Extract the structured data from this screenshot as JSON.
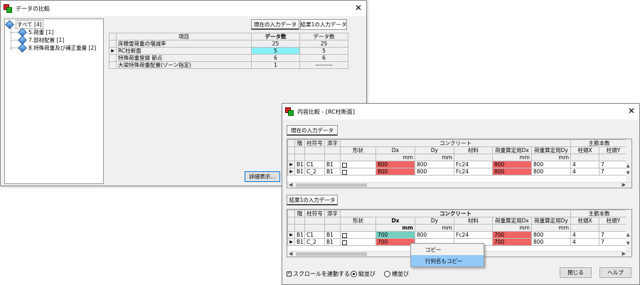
{
  "main_window": {
    "title": "データの比較",
    "tree": [
      {
        "label": "すべて [4]"
      },
      {
        "label": "5.荷重 [1]"
      },
      {
        "label": "7.部材配置 [1]"
      },
      {
        "label": "8.特殊荷重及び補正重量 [2]"
      }
    ],
    "tabs": {
      "current": "現在の入力データ",
      "result": "結果1の入力データ"
    },
    "table": {
      "headers": [
        "項目",
        "データ数",
        "データ数"
      ],
      "rows": [
        {
          "item": "床積雪荷重の増減率",
          "a": "25",
          "b": "25"
        },
        {
          "item": "RC柱断面",
          "a": "5",
          "b": "5"
        },
        {
          "item": "特殊荷重登録 節点",
          "a": "6",
          "b": "6"
        },
        {
          "item": "大梁特殊荷重配置(ゾーン指定)",
          "a": "1",
          "b": "---------"
        }
      ]
    },
    "detail_button": "詳細表示..."
  },
  "compare_window": {
    "title": "内容比較 - [RC柱断面]",
    "section_current": "現在の入力データ",
    "section_result": "結果1の入力データ",
    "header": {
      "kai": "階",
      "hashira": "柱符号",
      "soeji": "添字",
      "concrete": "コンクリート",
      "main_bar": "主筋本数",
      "keijo": "形状",
      "dx": "Dx",
      "dy": "Dy",
      "zairyo": "材料",
      "kajudx": "荷重算定用Dx",
      "kajudy": "荷重算定用Dy",
      "barx": "柱頭X",
      "bary": "柱頭Y",
      "unit": "mm"
    },
    "current_rows": [
      {
        "kai": "B1",
        "hashira": "C1",
        "soeji": "B1",
        "dx": "800",
        "dy": "800",
        "zairyo": "Fc24",
        "kdx": "800",
        "kdy": "800",
        "bx": "4",
        "by": "7"
      },
      {
        "kai": "B1",
        "hashira": "C_2",
        "soeji": "B1",
        "dx": "800",
        "dy": "800",
        "zairyo": "Fc24",
        "kdx": "800",
        "kdy": "800",
        "bx": "4",
        "by": "7"
      }
    ],
    "result_rows": [
      {
        "kai": "B1",
        "hashira": "C1",
        "soeji": "B1",
        "dx": "700",
        "dy": "800",
        "zairyo": "Fc24",
        "kdx": "700",
        "kdy": "800",
        "bx": "4",
        "by": "7"
      },
      {
        "kai": "B1",
        "hashira": "C_2",
        "soeji": "B1",
        "dx": "700",
        "dy": "",
        "zairyo": "",
        "kdx": "700",
        "kdy": "800",
        "bx": "4",
        "by": "7"
      }
    ],
    "context_menu": [
      "コピー",
      "行列名もコピー"
    ],
    "sync_scroll": "スクロールを連動する",
    "radio_vertical": "縦並び",
    "radio_horizontal": "横並び",
    "close_button": "閉じる",
    "help_button": "ヘルプ"
  },
  "colors": {
    "highlight_cyan": "#88eef8",
    "diff_red": "#f06464",
    "diff_teal": "#74cfc0",
    "menu_highlight": "#91c9f7"
  }
}
